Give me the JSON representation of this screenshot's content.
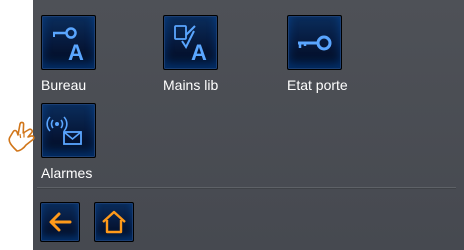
{
  "tiles": [
    {
      "label": "Bureau",
      "icon": "key-a-icon"
    },
    {
      "label": "Mains lib",
      "icon": "handsfree-a-icon"
    },
    {
      "label": "Etat porte",
      "icon": "key-icon"
    },
    {
      "label": "Alarmes",
      "icon": "alarm-mail-icon"
    }
  ],
  "nav": {
    "back_icon": "arrow-left-icon",
    "home_icon": "home-icon"
  },
  "icon_glyphs": {
    "a_letter": "A"
  },
  "colors": {
    "panel": "#4a4d53",
    "tile_bg": "#06183a",
    "icon_blue": "#5aa6ff",
    "nav_orange": "#ff9a1a",
    "label": "#ffffff"
  }
}
